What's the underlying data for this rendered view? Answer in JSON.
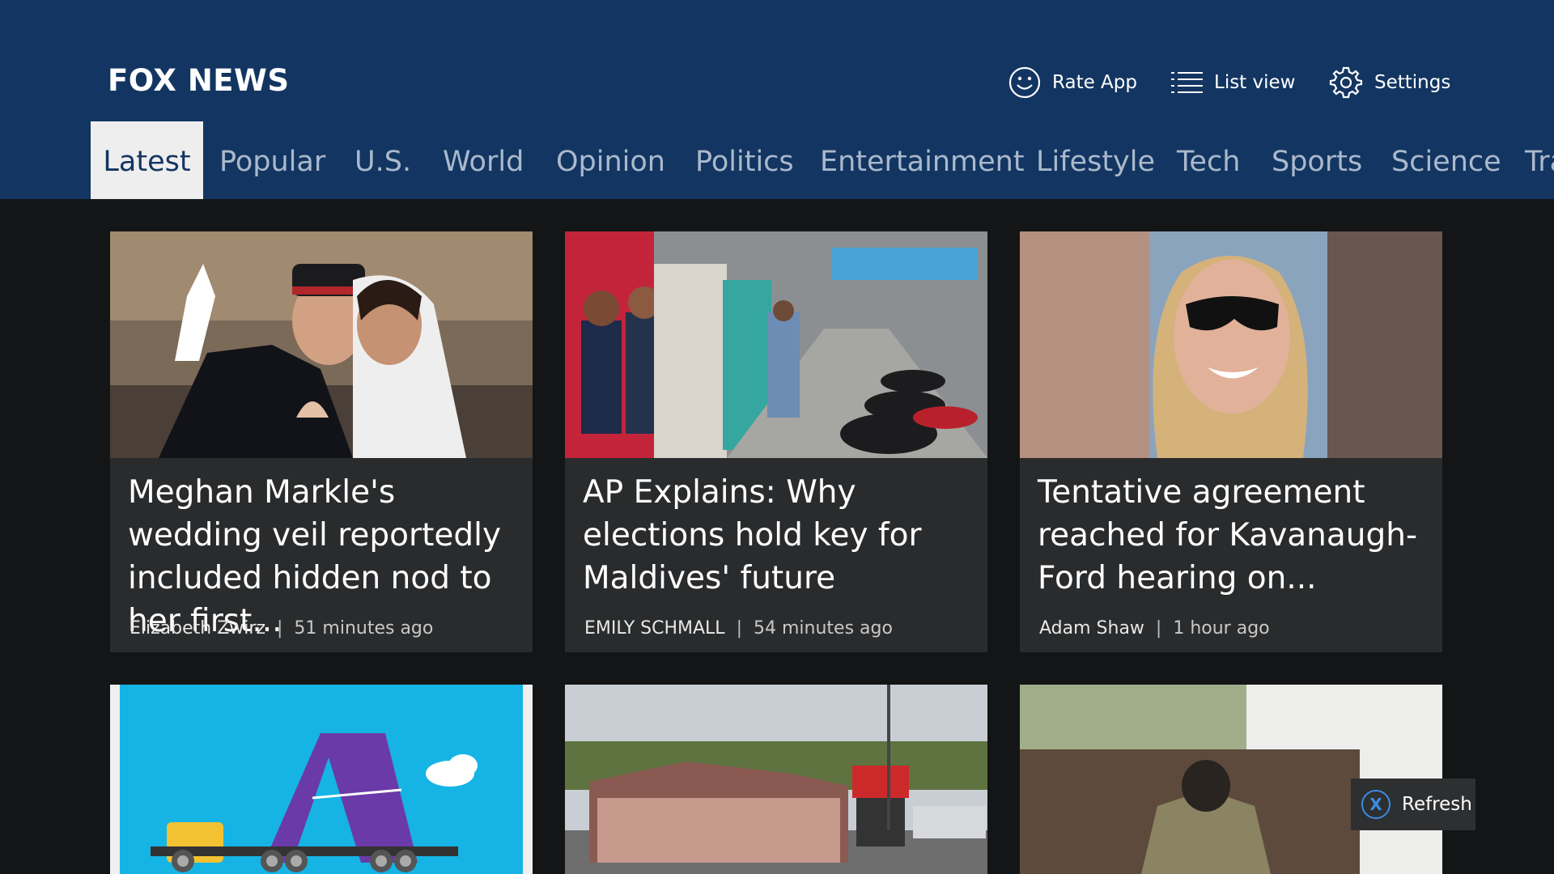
{
  "app": {
    "title": "FOX NEWS"
  },
  "actions": {
    "rate_app": "Rate App",
    "list_view": "List view",
    "settings": "Settings"
  },
  "tabs": [
    {
      "label": "Latest",
      "active": true
    },
    {
      "label": "Popular"
    },
    {
      "label": "U.S."
    },
    {
      "label": "World"
    },
    {
      "label": "Opinion"
    },
    {
      "label": "Politics"
    },
    {
      "label": "Entertainment"
    },
    {
      "label": "Lifestyle"
    },
    {
      "label": "Tech"
    },
    {
      "label": "Sports"
    },
    {
      "label": "Science"
    },
    {
      "label": "Tra"
    }
  ],
  "articles": [
    {
      "headline": "Meghan Markle's wedding veil reportedly included hidden nod to her first...",
      "author": "Elizabeth Zwirz",
      "time": "51 minutes ago"
    },
    {
      "headline": "AP Explains: Why elections hold key for Maldives' future",
      "author": "EMILY SCHMALL",
      "time": "54 minutes ago"
    },
    {
      "headline": "Tentative agreement reached for Kavanaugh-Ford hearing on...",
      "author": "Adam Shaw",
      "time": "1 hour ago"
    }
  ],
  "refresh": {
    "button_glyph": "X",
    "label": "Refresh"
  },
  "colors": {
    "header": "#133561",
    "background": "#141516",
    "card": "#2a2b2c",
    "accent": "#3b8de0"
  }
}
